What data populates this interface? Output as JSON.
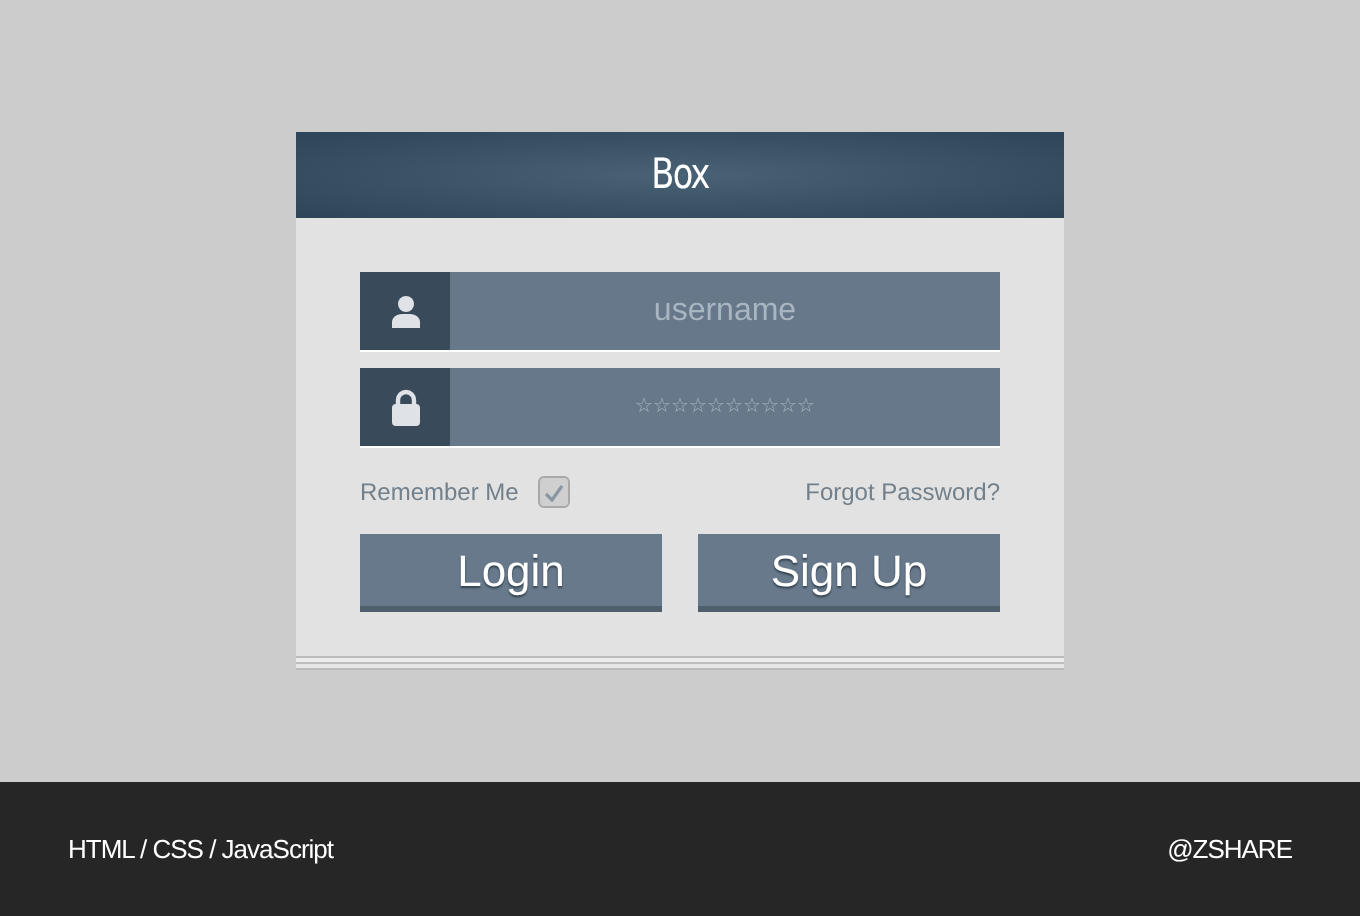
{
  "box": {
    "title": "Box"
  },
  "fields": [
    {
      "kind": "user",
      "placeholder": "username"
    },
    {
      "kind": "lock",
      "placeholder": "☆☆☆☆☆☆☆☆☆☆"
    }
  ],
  "remember": {
    "label": "Remember Me",
    "checked": true
  },
  "forgot_link": "Forgot Password?",
  "buttons": [
    "Login",
    "Sign Up"
  ],
  "footer": {
    "left": "HTML / CSS / JavaScript",
    "right": "@ZSHARE"
  }
}
